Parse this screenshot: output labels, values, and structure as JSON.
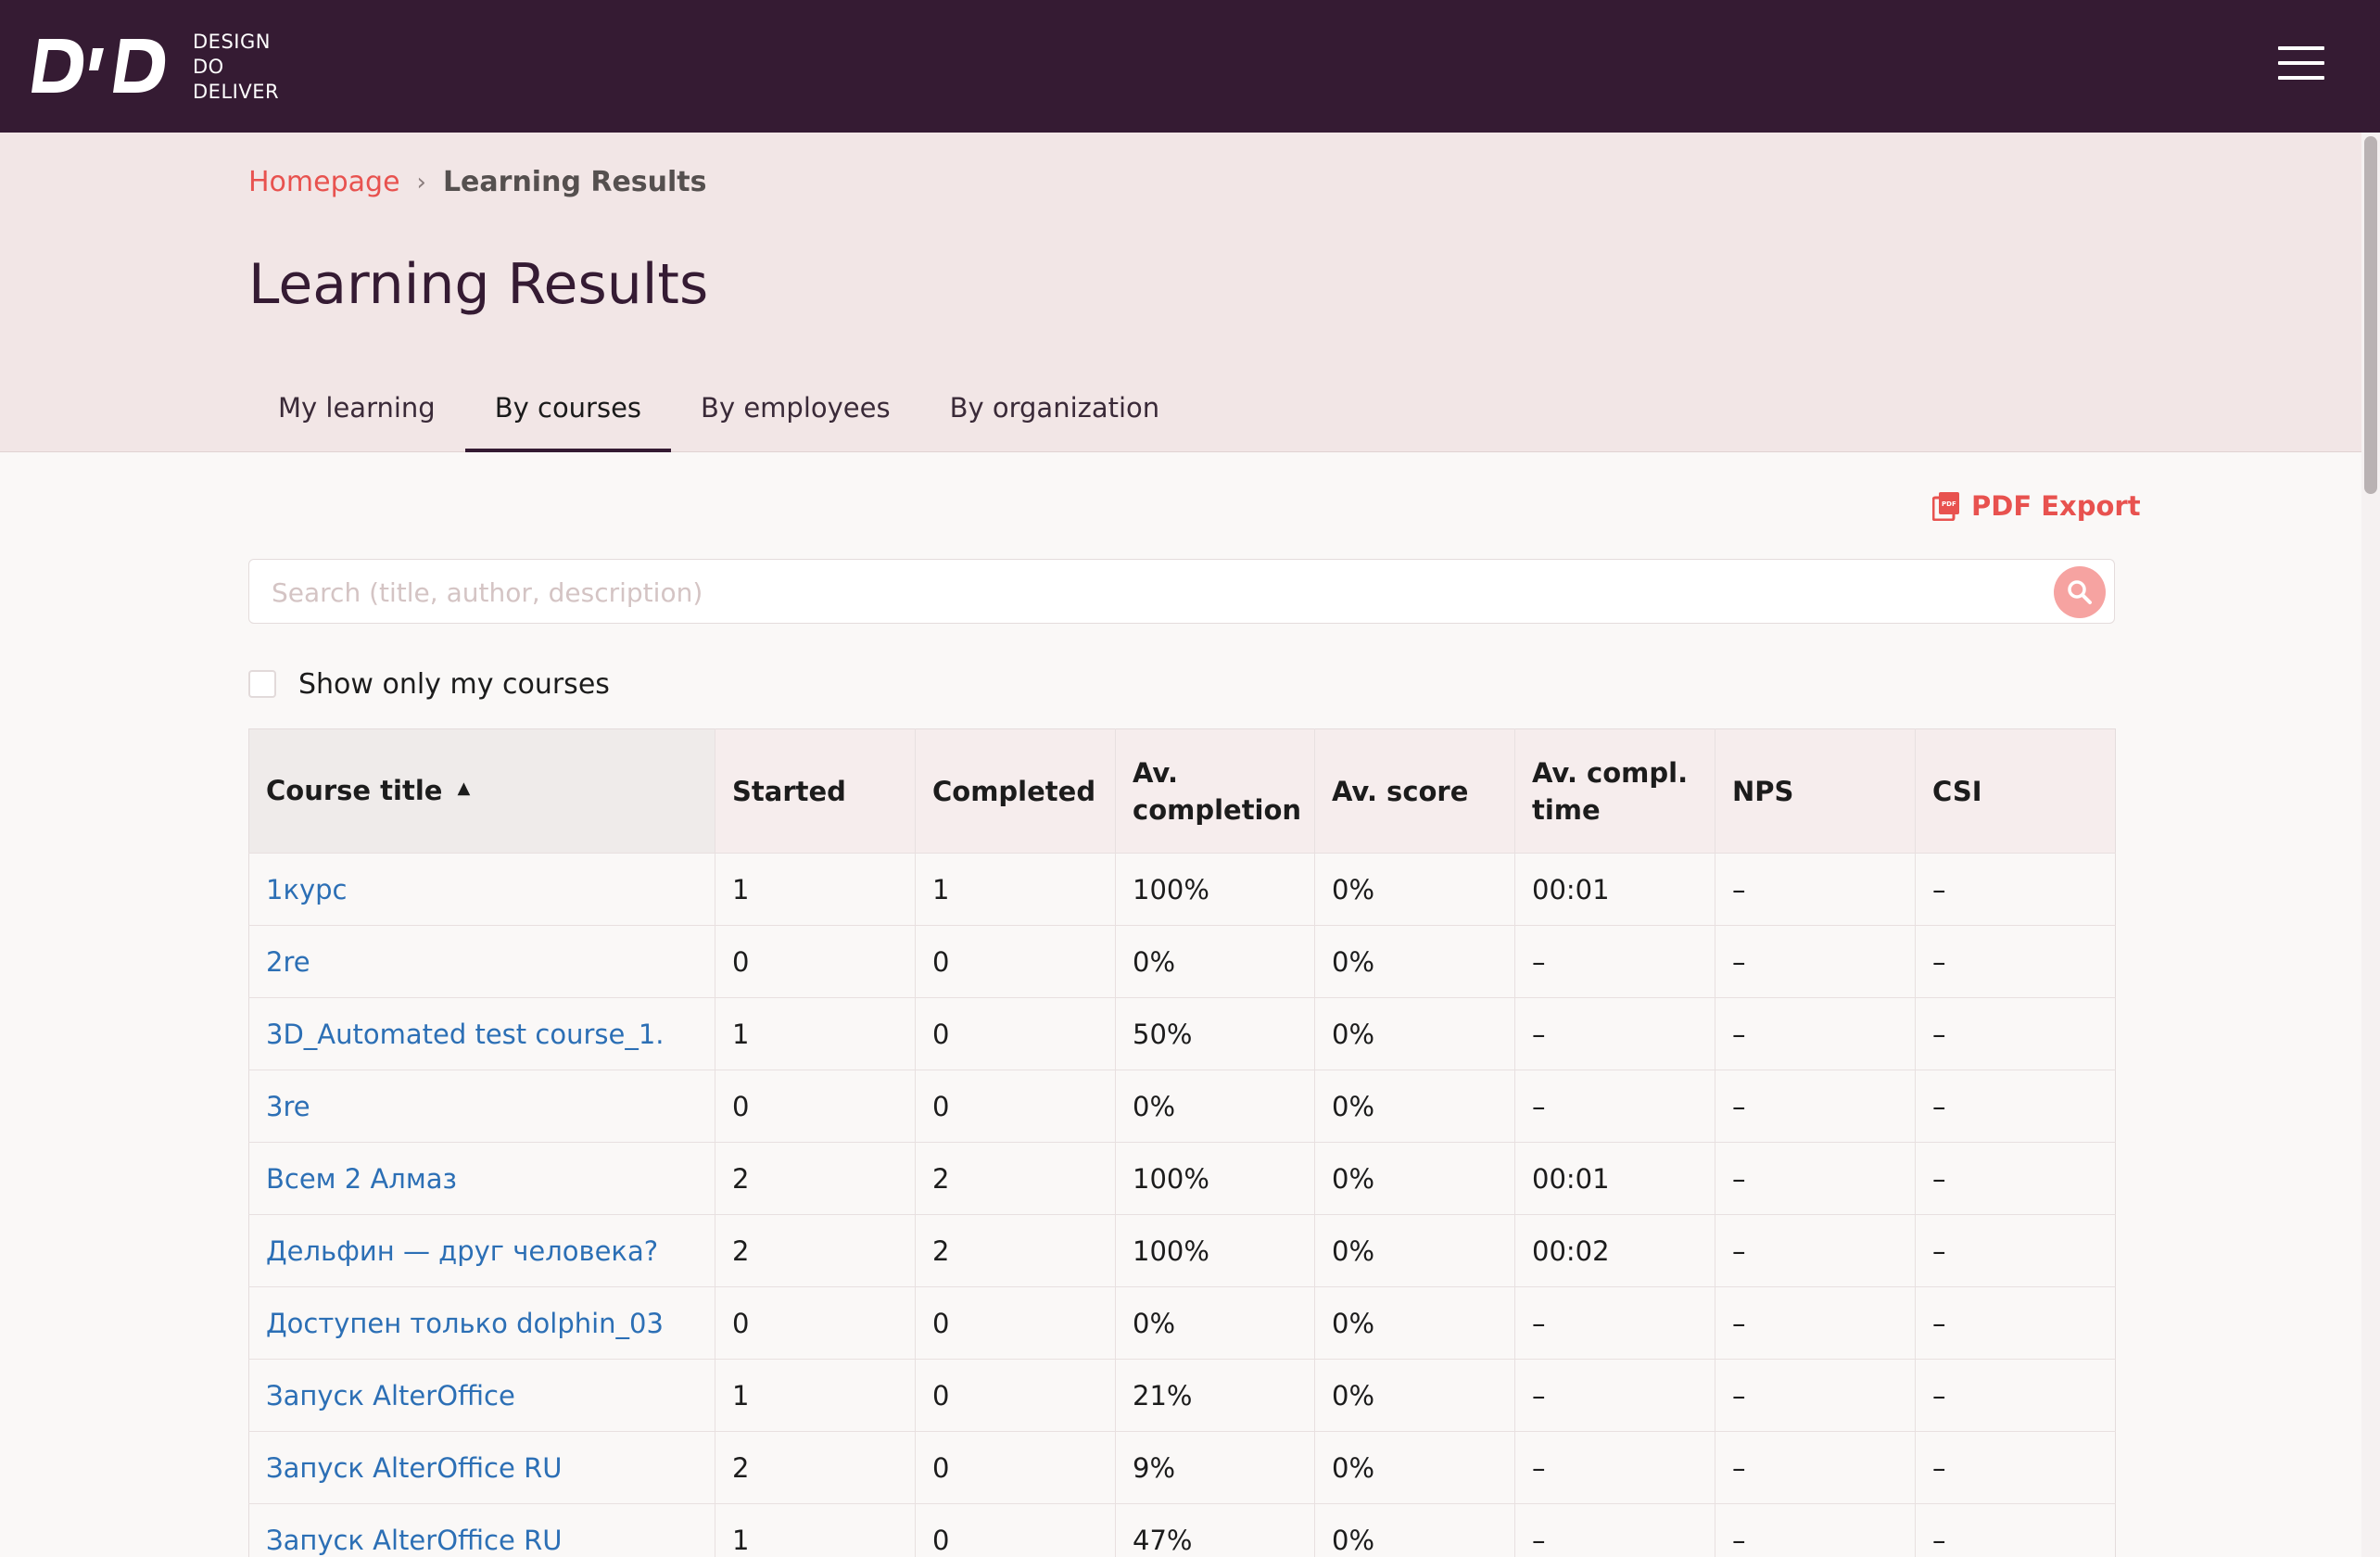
{
  "brand": {
    "logo_name": "ddd-logo",
    "line1": "DESIGN",
    "line2": "DO",
    "line3": "DELIVER",
    "header_color": "#351b33"
  },
  "breadcrumb": {
    "home": "Homepage",
    "separator": "›",
    "current": "Learning Results"
  },
  "page_title": "Learning Results",
  "tabs": [
    {
      "label": "My learning",
      "active": false
    },
    {
      "label": "By courses",
      "active": true
    },
    {
      "label": "By employees",
      "active": false
    },
    {
      "label": "By organization",
      "active": false
    }
  ],
  "pdf_export": {
    "label": "PDF Export",
    "icon": "pdf-icon"
  },
  "search": {
    "placeholder": "Search (title, author, description)",
    "value": "",
    "icon": "search-icon"
  },
  "filter": {
    "only_mine_label": "Show only my courses",
    "checked": false
  },
  "table": {
    "headers": [
      {
        "label": "Course title",
        "sorted": "asc"
      },
      {
        "label": "Started"
      },
      {
        "label": "Completed"
      },
      {
        "label": "Av. completion"
      },
      {
        "label": "Av. score"
      },
      {
        "label": "Av. compl. time"
      },
      {
        "label": "NPS"
      },
      {
        "label": "CSI"
      }
    ],
    "sort_indicator": "▲",
    "rows": [
      [
        "1курс",
        "1",
        "1",
        "100%",
        "0%",
        "00:01",
        "–",
        "–"
      ],
      [
        "2re",
        "0",
        "0",
        "0%",
        "0%",
        "–",
        "–",
        "–"
      ],
      [
        "3D_Automated test course_1.",
        "1",
        "0",
        "50%",
        "0%",
        "–",
        "–",
        "–"
      ],
      [
        "3re",
        "0",
        "0",
        "0%",
        "0%",
        "–",
        "–",
        "–"
      ],
      [
        "Всем 2 Алмаз",
        "2",
        "2",
        "100%",
        "0%",
        "00:01",
        "–",
        "–"
      ],
      [
        "Дельфин — друг человека?",
        "2",
        "2",
        "100%",
        "0%",
        "00:02",
        "–",
        "–"
      ],
      [
        "Доступен только dolphin_03",
        "0",
        "0",
        "0%",
        "0%",
        "–",
        "–",
        "–"
      ],
      [
        "Запуск AlterOffice",
        "1",
        "0",
        "21%",
        "0%",
        "–",
        "–",
        "–"
      ],
      [
        "Запуск AlterOffice RU",
        "2",
        "0",
        "9%",
        "0%",
        "–",
        "–",
        "–"
      ],
      [
        "Запуск AlterOffice RU",
        "1",
        "0",
        "47%",
        "0%",
        "–",
        "–",
        "–"
      ]
    ]
  },
  "colors": {
    "accent": "#e8524f",
    "link": "#2c6fb5",
    "hero_bg": "#f2e6e6"
  }
}
